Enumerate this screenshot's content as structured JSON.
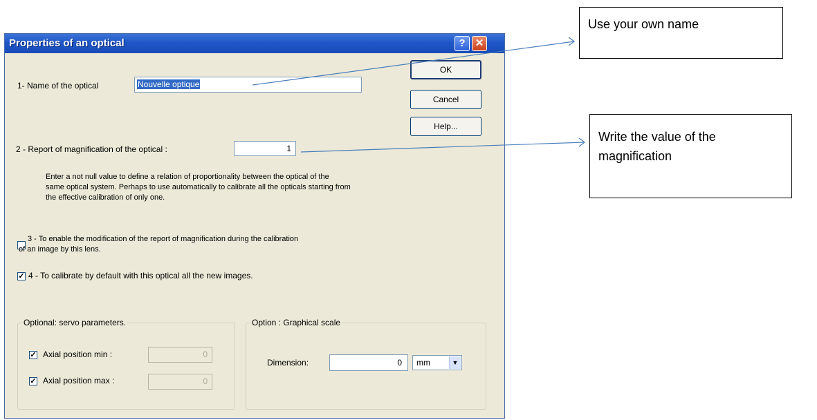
{
  "dialog": {
    "title": "Properties of an optical",
    "help_glyph": "?",
    "close_glyph": "✕",
    "buttons": {
      "ok": "OK",
      "cancel": "Cancel",
      "help": "Help..."
    },
    "item1": {
      "label": "1- Name of the optical",
      "value": "Nouvelle optique"
    },
    "item2": {
      "label": "2 - Report of magnification of the optical :",
      "value": "1",
      "description": [
        "Enter a not null value to define a relation of proportionality between the optical of the",
        "same optical system. Perhaps to use automatically to calibrate all the opticals starting from",
        "the effective calibration of only one."
      ]
    },
    "item3": {
      "checked": false,
      "lines": [
        "3 - To enable the modification of the report of magnification during the calibration",
        "of an image by this lens."
      ]
    },
    "item4": {
      "checked": true,
      "label": "4 - To calibrate by default with this optical all the new images."
    },
    "servo": {
      "legend": "Optional: servo parameters.",
      "min": {
        "checked": true,
        "label": "Axial position min :",
        "value": "0"
      },
      "max": {
        "checked": true,
        "label": "Axial position max :",
        "value": "0"
      }
    },
    "scale": {
      "legend": "Option : Graphical scale",
      "dimension_label": "Dimension:",
      "dimension_value": "0",
      "unit": "mm",
      "dropdown_glyph": "▼"
    }
  },
  "annotations": {
    "note1": "Use your own name",
    "note2": [
      "Write the value of the",
      "magnification"
    ],
    "arrow_color": "#4a7ebb"
  }
}
